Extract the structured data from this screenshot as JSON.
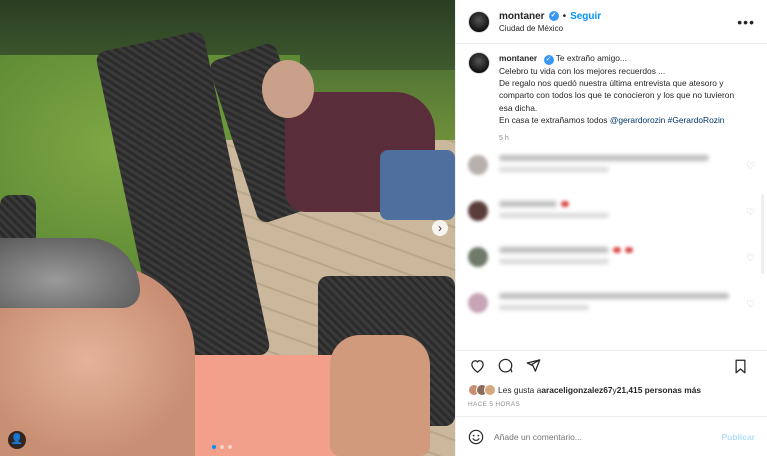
{
  "header": {
    "username": "montaner",
    "separator": "•",
    "follow_label": "Seguir",
    "location": "Ciudad de México",
    "more_icon": "more-horizontal-icon"
  },
  "caption": {
    "username": "montaner",
    "line1": "Te extraño amigo...",
    "line2": "Celebro tu vida con los mejores recuerdos ...",
    "line3": "De regalo nos quedó nuestra última entrevista que atesoro y comparto con todos los que te conocieron y los que no tuvieron esa dicha.",
    "line4_prefix": "En casa te extrañamos todos ",
    "mention": "@gerardorozin",
    "hashtag": "#GerardoRozin",
    "time": "5 h"
  },
  "likes": {
    "prefix": "Les gusta a ",
    "user": "araceligonzalez67",
    "middle": " y ",
    "count": "21,415 personas más"
  },
  "posted_ago": "HACE 5 HORAS",
  "comment_box": {
    "placeholder": "Añade un comentario...",
    "publish_label": "Publicar"
  },
  "colors": {
    "accent": "#0095f6",
    "verified": "#3897f0",
    "publish_disabled": "#b2dffc"
  },
  "icons": {
    "like": "heart-icon",
    "comment": "comment-icon",
    "share": "send-icon",
    "save": "bookmark-icon",
    "emoji": "emoji-icon",
    "next": "chevron-right-icon",
    "tag": "user-tag-icon"
  },
  "carousel": {
    "next_label": "›",
    "tag_label": "👤"
  }
}
